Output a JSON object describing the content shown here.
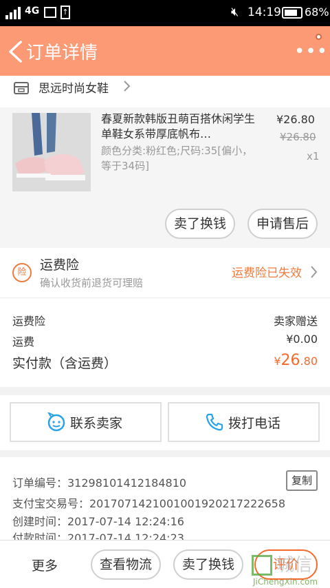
{
  "status_bar": {
    "network": "4G",
    "time": "14:19",
    "battery": "68%"
  },
  "header": {
    "title": "订单详情",
    "more_label": "•••"
  },
  "shop": {
    "name": "思远时尚女鞋"
  },
  "product": {
    "title": "春夏新款韩版丑萌百搭休闲学生单鞋女系带厚底帆布…",
    "spec": "颜色分类:粉红色;尺码:35[偏小，等于34码]",
    "price": "¥26.80",
    "original_price": "¥26.80",
    "quantity": "x1",
    "sell_button": "卖了换钱",
    "after_sale_button": "申请售后"
  },
  "insurance": {
    "badge": "险",
    "name": "运费险",
    "subtitle": "确认收货前退货可理赔",
    "status": "运费险已失效"
  },
  "fees": {
    "rows": [
      {
        "label": "运费险",
        "value": "卖家赠送"
      },
      {
        "label": "运费",
        "value": "¥0.00"
      }
    ],
    "total_label": "实付款（含运费）",
    "total_currency": "¥",
    "total_main": "26",
    "total_cents": ".80"
  },
  "contact": {
    "seller_label": "联系卖家",
    "phone_label": "拨打电话"
  },
  "order_info": {
    "order_no": "订单编号：31298101412184810",
    "alipay_no": "支付宝交易号：2017071421001001920217222658",
    "created": "创建时间：2017-07-14 12:24:16",
    "paid": "付款时间：2017-07-14 12:24:23",
    "copy_label": "复制"
  },
  "bottom_bar": {
    "more": "更多",
    "logistics": "查看物流",
    "sell": "卖了换钱",
    "review": "评价"
  },
  "watermark": {
    "text": "城信",
    "url": "JiChengXin.com"
  },
  "colors": {
    "header_bg": "#fc9a76",
    "accent": "#f56a2a",
    "insurance": "#f07a3d"
  }
}
